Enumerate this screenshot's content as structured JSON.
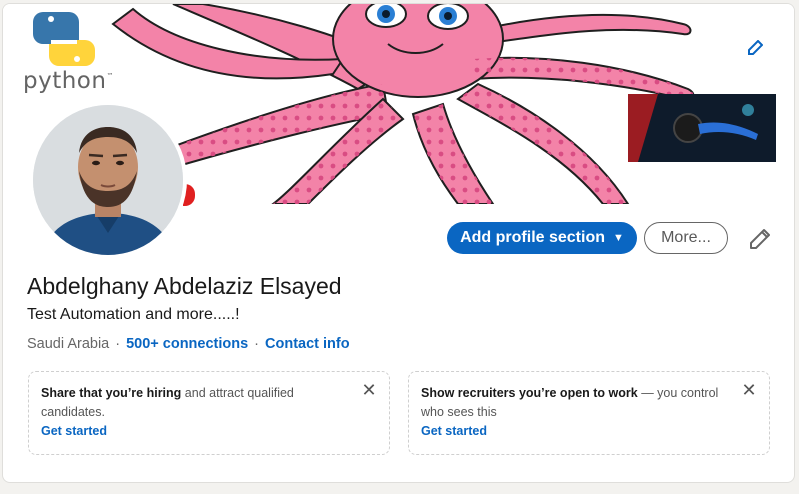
{
  "cover": {
    "logo_text": "python",
    "logo_tm": "™"
  },
  "actions": {
    "add_profile_section": "Add profile section",
    "more": "More..."
  },
  "profile": {
    "name": "Abdelghany Abdelaziz Elsayed",
    "headline": "Test Automation and more.....!",
    "location": "Saudi Arabia",
    "separator": "·",
    "connections": "500+ connections",
    "contact_info": "Contact info"
  },
  "promos": [
    {
      "lead": "Share that you’re hiring",
      "rest": " and attract qualified candidates.",
      "cta": "Get started"
    },
    {
      "lead": "Show recruiters you’re open to work",
      "rest": " — you control who sees this",
      "cta": "Get started"
    }
  ],
  "colors": {
    "primary_blue": "#0a66c2",
    "page_bg": "#f3f2ef",
    "octopus_pink": "#f383a8"
  },
  "icons": [
    "pencil-icon",
    "close-icon",
    "caret-down-icon",
    "python-logo-icon"
  ]
}
